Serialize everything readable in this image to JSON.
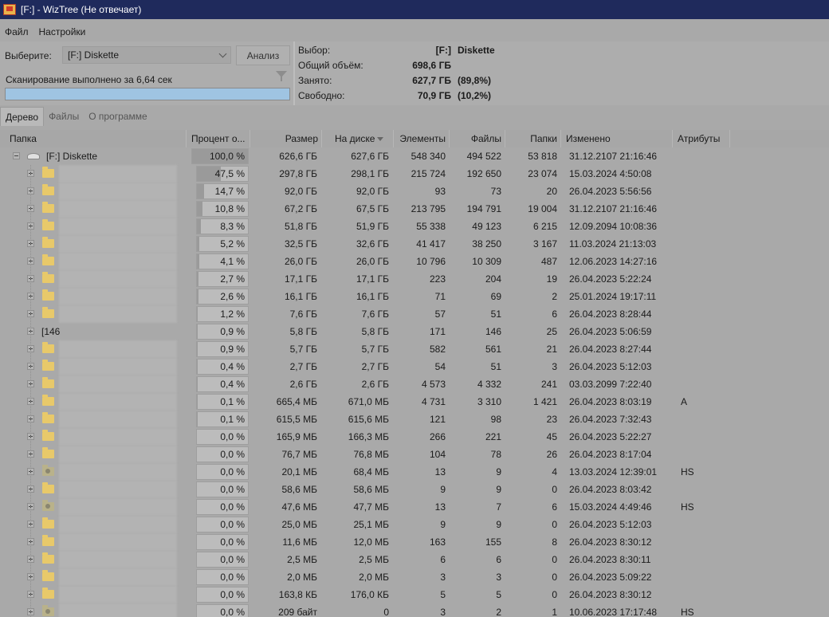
{
  "window": {
    "title": "[F:]  - WizTree (Не отвечает)"
  },
  "menu": [
    "Файл",
    "Настройки"
  ],
  "scan": {
    "select_label": "Выберите:",
    "drive_value": "[F:] Diskette",
    "analyze_label": "Анализ",
    "status": "Сканирование выполнено за 6,64 сек",
    "progress_fraction": 1.0
  },
  "summary": [
    {
      "label": "Выбор:",
      "value": "[F:]",
      "extra": "Diskette"
    },
    {
      "label": "Общий объём:",
      "value": "698,6 ГБ",
      "extra": ""
    },
    {
      "label": "Занято:",
      "value": "627,7 ГБ",
      "extra": "(89,8%)"
    },
    {
      "label": "Свободно:",
      "value": "70,9 ГБ",
      "extra": "(10,2%)"
    }
  ],
  "tabs": [
    "Дерево",
    "Файлы",
    "О программе"
  ],
  "columns": {
    "folder": "Папка",
    "percent": "Процент о...",
    "size": "Размер",
    "disk": "На диске",
    "items": "Элементы",
    "files": "Файлы",
    "folders": "Папки",
    "modified": "Изменено",
    "attributes": "Атрибуты"
  },
  "rows": [
    {
      "name": "[F:] Diskette",
      "icon": "drive-icon",
      "pct": 100.0,
      "percent": "100,0 %",
      "size": "626,6 ГБ",
      "disk": "627,6 ГБ",
      "items": "548 340",
      "files": "494 522",
      "folders": "53 818",
      "modified": "31.12.2107 21:16:46",
      "attr": ""
    },
    {
      "name": "",
      "icon": "folder-icon",
      "pct": 47.5,
      "percent": "47,5 %",
      "size": "297,8 ГБ",
      "disk": "298,1 ГБ",
      "items": "215 724",
      "files": "192 650",
      "folders": "23 074",
      "modified": "15.03.2024 4:50:08",
      "attr": ""
    },
    {
      "name": "",
      "icon": "folder-icon",
      "pct": 14.7,
      "percent": "14,7 %",
      "size": "92,0 ГБ",
      "disk": "92,0 ГБ",
      "items": "93",
      "files": "73",
      "folders": "20",
      "modified": "26.04.2023 5:56:56",
      "attr": ""
    },
    {
      "name": "",
      "icon": "folder-icon",
      "pct": 10.8,
      "percent": "10,8 %",
      "size": "67,2 ГБ",
      "disk": "67,5 ГБ",
      "items": "213 795",
      "files": "194 791",
      "folders": "19 004",
      "modified": "31.12.2107 21:16:46",
      "attr": ""
    },
    {
      "name": "",
      "icon": "folder-icon",
      "pct": 8.3,
      "percent": "8,3 %",
      "size": "51,8 ГБ",
      "disk": "51,9 ГБ",
      "items": "55 338",
      "files": "49 123",
      "folders": "6 215",
      "modified": "12.09.2094 10:08:36",
      "attr": ""
    },
    {
      "name": "",
      "icon": "folder-icon",
      "pct": 5.2,
      "percent": "5,2 %",
      "size": "32,5 ГБ",
      "disk": "32,6 ГБ",
      "items": "41 417",
      "files": "38 250",
      "folders": "3 167",
      "modified": "11.03.2024 21:13:03",
      "attr": ""
    },
    {
      "name": "",
      "icon": "folder-icon",
      "pct": 4.1,
      "percent": "4,1 %",
      "size": "26,0 ГБ",
      "disk": "26,0 ГБ",
      "items": "10 796",
      "files": "10 309",
      "folders": "487",
      "modified": "12.06.2023 14:27:16",
      "attr": ""
    },
    {
      "name": "",
      "icon": "folder-icon",
      "pct": 2.7,
      "percent": "2,7 %",
      "size": "17,1 ГБ",
      "disk": "17,1 ГБ",
      "items": "223",
      "files": "204",
      "folders": "19",
      "modified": "26.04.2023 5:22:24",
      "attr": ""
    },
    {
      "name": "",
      "icon": "folder-icon",
      "pct": 2.6,
      "percent": "2,6 %",
      "size": "16,1 ГБ",
      "disk": "16,1 ГБ",
      "items": "71",
      "files": "69",
      "folders": "2",
      "modified": "25.01.2024 19:17:11",
      "attr": ""
    },
    {
      "name": "",
      "icon": "folder-icon",
      "pct": 1.2,
      "percent": "1,2 %",
      "size": "7,6 ГБ",
      "disk": "7,6 ГБ",
      "items": "57",
      "files": "51",
      "folders": "6",
      "modified": "26.04.2023 8:28:44",
      "attr": ""
    },
    {
      "name": "[146",
      "icon": "",
      "pct": 0.9,
      "percent": "0,9 %",
      "size": "5,8 ГБ",
      "disk": "5,8 ГБ",
      "items": "171",
      "files": "146",
      "folders": "25",
      "modified": "26.04.2023 5:06:59",
      "attr": ""
    },
    {
      "name": "",
      "icon": "folder-icon",
      "pct": 0.9,
      "percent": "0,9 %",
      "size": "5,7 ГБ",
      "disk": "5,7 ГБ",
      "items": "582",
      "files": "561",
      "folders": "21",
      "modified": "26.04.2023 8:27:44",
      "attr": ""
    },
    {
      "name": "",
      "icon": "folder-icon",
      "pct": 0.4,
      "percent": "0,4 %",
      "size": "2,7 ГБ",
      "disk": "2,7 ГБ",
      "items": "54",
      "files": "51",
      "folders": "3",
      "modified": "26.04.2023 5:12:03",
      "attr": ""
    },
    {
      "name": "",
      "icon": "folder-icon",
      "pct": 0.4,
      "percent": "0,4 %",
      "size": "2,6 ГБ",
      "disk": "2,6 ГБ",
      "items": "4 573",
      "files": "4 332",
      "folders": "241",
      "modified": "03.03.2099 7:22:40",
      "attr": ""
    },
    {
      "name": "",
      "icon": "folder-icon",
      "pct": 0.1,
      "percent": "0,1 %",
      "size": "665,4 МБ",
      "disk": "671,0 МБ",
      "items": "4 731",
      "files": "3 310",
      "folders": "1 421",
      "modified": "26.04.2023 8:03:19",
      "attr": "A"
    },
    {
      "name": "",
      "icon": "folder-icon",
      "pct": 0.1,
      "percent": "0,1 %",
      "size": "615,5 МБ",
      "disk": "615,6 МБ",
      "items": "121",
      "files": "98",
      "folders": "23",
      "modified": "26.04.2023 7:32:43",
      "attr": ""
    },
    {
      "name": "",
      "icon": "folder-icon",
      "pct": 0.0,
      "percent": "0,0 %",
      "size": "165,9 МБ",
      "disk": "166,3 МБ",
      "items": "266",
      "files": "221",
      "folders": "45",
      "modified": "26.04.2023 5:22:27",
      "attr": ""
    },
    {
      "name": "",
      "icon": "folder-icon",
      "pct": 0.0,
      "percent": "0,0 %",
      "size": "76,7 МБ",
      "disk": "76,8 МБ",
      "items": "104",
      "files": "78",
      "folders": "26",
      "modified": "26.04.2023 8:17:04",
      "attr": ""
    },
    {
      "name": "",
      "icon": "special-folder-icon",
      "pct": 0.0,
      "percent": "0,0 %",
      "size": "20,1 МБ",
      "disk": "68,4 МБ",
      "items": "13",
      "files": "9",
      "folders": "4",
      "modified": "13.03.2024 12:39:01",
      "attr": "HS"
    },
    {
      "name": "",
      "icon": "folder-icon",
      "pct": 0.0,
      "percent": "0,0 %",
      "size": "58,6 МБ",
      "disk": "58,6 МБ",
      "items": "9",
      "files": "9",
      "folders": "0",
      "modified": "26.04.2023 8:03:42",
      "attr": ""
    },
    {
      "name": "",
      "icon": "special-folder-icon",
      "pct": 0.0,
      "percent": "0,0 %",
      "size": "47,6 МБ",
      "disk": "47,7 МБ",
      "items": "13",
      "files": "7",
      "folders": "6",
      "modified": "15.03.2024 4:49:46",
      "attr": "HS"
    },
    {
      "name": "",
      "icon": "folder-icon",
      "pct": 0.0,
      "percent": "0,0 %",
      "size": "25,0 МБ",
      "disk": "25,1 МБ",
      "items": "9",
      "files": "9",
      "folders": "0",
      "modified": "26.04.2023 5:12:03",
      "attr": ""
    },
    {
      "name": "",
      "icon": "folder-icon",
      "pct": 0.0,
      "percent": "0,0 %",
      "size": "11,6 МБ",
      "disk": "12,0 МБ",
      "items": "163",
      "files": "155",
      "folders": "8",
      "modified": "26.04.2023 8:30:12",
      "attr": ""
    },
    {
      "name": "",
      "icon": "folder-icon",
      "pct": 0.0,
      "percent": "0,0 %",
      "size": "2,5 МБ",
      "disk": "2,5 МБ",
      "items": "6",
      "files": "6",
      "folders": "0",
      "modified": "26.04.2023 8:30:11",
      "attr": ""
    },
    {
      "name": "",
      "icon": "folder-icon",
      "pct": 0.0,
      "percent": "0,0 %",
      "size": "2,0 МБ",
      "disk": "2,0 МБ",
      "items": "3",
      "files": "3",
      "folders": "0",
      "modified": "26.04.2023 5:09:22",
      "attr": ""
    },
    {
      "name": "",
      "icon": "folder-icon",
      "pct": 0.0,
      "percent": "0,0 %",
      "size": "163,8 КБ",
      "disk": "176,0 КБ",
      "items": "5",
      "files": "5",
      "folders": "0",
      "modified": "26.04.2023 8:30:12",
      "attr": ""
    },
    {
      "name": "",
      "icon": "special-folder-icon",
      "pct": 0.0,
      "percent": "0,0 %",
      "size": "209 байт",
      "disk": "0",
      "items": "3",
      "files": "2",
      "folders": "1",
      "modified": "10.06.2023 17:17:48",
      "attr": "HS"
    }
  ]
}
